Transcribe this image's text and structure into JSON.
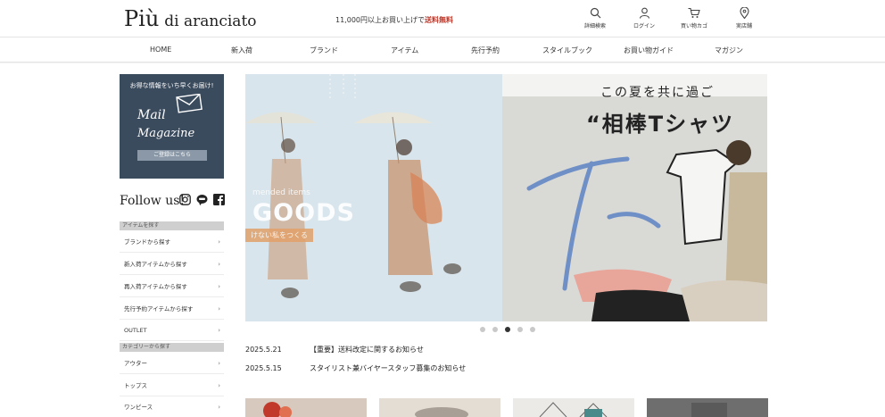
{
  "header": {
    "logo_main": "Più",
    "logo_sub": "di aranciato",
    "ship_note_prefix": "11,000円以上お買い上げで",
    "ship_note_bold": "送料無料",
    "icons": [
      {
        "icon": "search-icon",
        "label": "詳細検索"
      },
      {
        "icon": "user-icon",
        "label": "ログイン"
      },
      {
        "icon": "cart-icon",
        "label": "買い物カゴ"
      },
      {
        "icon": "map-pin-icon",
        "label": "実店舗"
      }
    ]
  },
  "nav": {
    "items": [
      "HOME",
      "新入荷",
      "ブランド",
      "アイテム",
      "先行予約",
      "スタイルブック",
      "お買い物ガイド",
      "マガジン"
    ]
  },
  "sidebar": {
    "mail_title": "お得な情報をいち早くお届け!",
    "mail_art_line1": "Mail",
    "mail_art_line2": "Magazine",
    "mail_button": "ご登録はこちら",
    "follow_text": "Follow us!",
    "social": [
      "instagram-icon",
      "line-icon",
      "facebook-icon"
    ],
    "section_items": "アイテムを探す",
    "item_links": [
      "ブランドから探す",
      "新入荷アイテムから探す",
      "再入荷アイテムから探す",
      "先行予約アイテムから探す",
      "OUTLET"
    ],
    "section_category": "カテゴリーから探す",
    "category_links": [
      "アウター",
      "トップス",
      "ワンピース"
    ]
  },
  "slider": {
    "left_caption_top": "mended items",
    "left_caption_main": "GOODS",
    "left_caption_sub": "けない私をつくる",
    "right_copy_line1": "この夏を共に過ご",
    "right_copy_line2": "“相棒Tシャツ",
    "dots": 5,
    "active_dot": 2
  },
  "news": [
    {
      "date": "2025.5.21",
      "title": "【重要】送料改定に関するお知らせ"
    },
    {
      "date": "2025.5.15",
      "title": "スタイリスト兼バイヤースタッフ募集のお知らせ"
    }
  ],
  "colors": {
    "mail_bg": "#3b4b5e",
    "section_head": "#cfcfcf",
    "accent_red": "#c0392b"
  }
}
